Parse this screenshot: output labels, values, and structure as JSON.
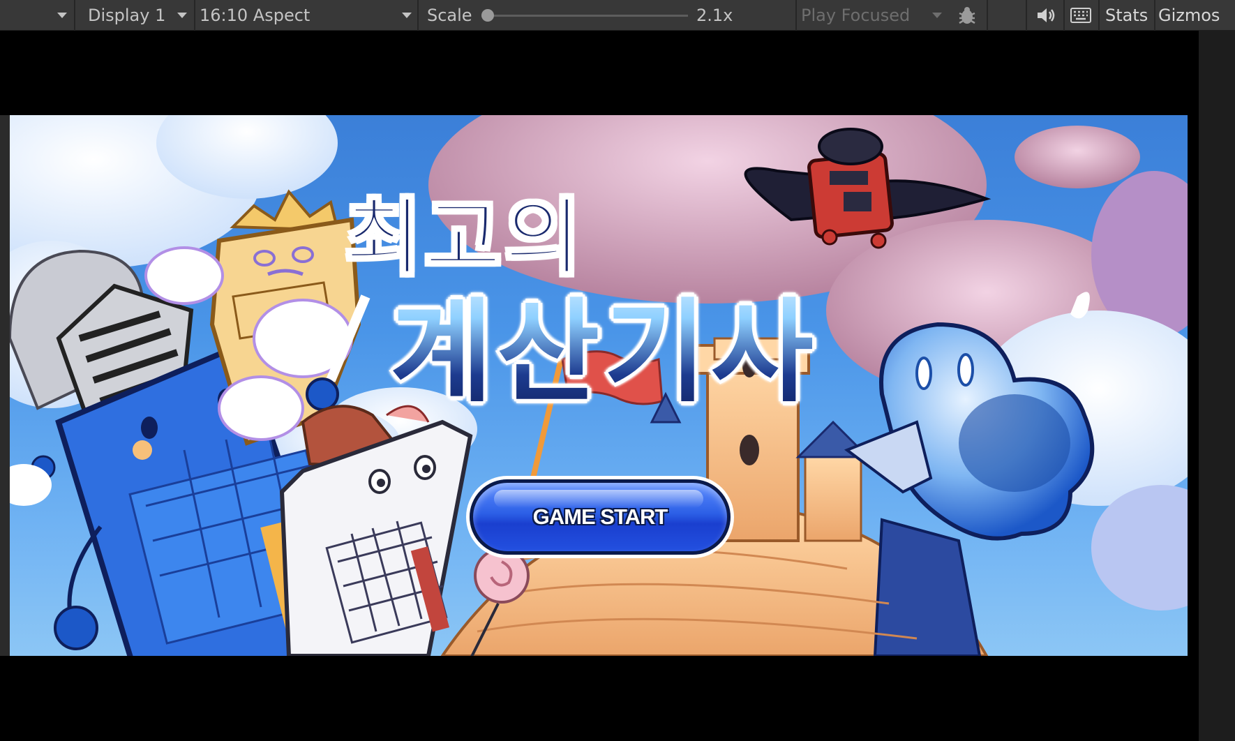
{
  "toolbar": {
    "display_label": "Display 1",
    "aspect_label": "16:10 Aspect",
    "scale_label": "Scale",
    "scale_value": "2.1x",
    "scale_fraction": 0.03,
    "play_mode_label": "Play Focused",
    "stats_label": "Stats",
    "gizmos_label": "Gizmos"
  },
  "game": {
    "title_line1": "최고의",
    "title_line2": "계산기사",
    "start_button_label": "GAME START"
  },
  "colors": {
    "toolbar_bg": "#383838",
    "sky": "#4a95e8",
    "button_blue": "#2c5fe6",
    "title_navy": "#1a2a6e"
  },
  "icons": [
    "dropdown-arrow-icon",
    "bug-icon",
    "speaker-icon",
    "keyboard-icon"
  ]
}
